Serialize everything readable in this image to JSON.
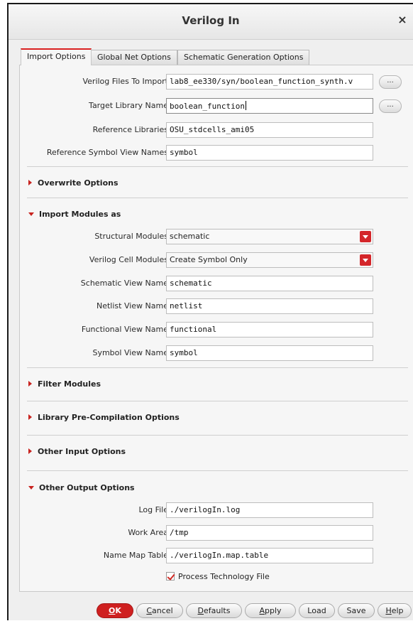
{
  "window": {
    "title": "Verilog In",
    "close_glyph": "×"
  },
  "tabs": [
    {
      "label": "Import Options",
      "active": true
    },
    {
      "label": "Global Net Options",
      "active": false
    },
    {
      "label": "Schematic Generation Options",
      "active": false
    }
  ],
  "fields": {
    "verilog_files": {
      "label": "Verilog Files To Import",
      "value": "lab8_ee330/syn/boolean_function_synth.v"
    },
    "target_library": {
      "label": "Target Library Name",
      "value": "boolean_function"
    },
    "reference_libraries": {
      "label": "Reference Libraries",
      "value": "OSU_stdcells_ami05"
    },
    "reference_symbol_views": {
      "label": "Reference Symbol View Names",
      "value": "symbol"
    }
  },
  "browse_label": "...",
  "sections": {
    "overwrite": "Overwrite Options",
    "import_modules": "Import Modules as",
    "filter_modules": "Filter Modules",
    "library_precompilation": "Library Pre-Compilation Options",
    "other_input": "Other Input Options",
    "other_output": "Other Output Options"
  },
  "import_modules": {
    "structural_modules": {
      "label": "Structural Modules",
      "value": "schematic"
    },
    "verilog_cell_modules": {
      "label": "Verilog Cell Modules",
      "value": "Create Symbol Only"
    },
    "schematic_view_name": {
      "label": "Schematic View Name",
      "value": "schematic"
    },
    "netlist_view_name": {
      "label": "Netlist View Name",
      "value": "netlist"
    },
    "functional_view_name": {
      "label": "Functional View Name",
      "value": "functional"
    },
    "symbol_view_name": {
      "label": "Symbol View Name",
      "value": "symbol"
    }
  },
  "other_output": {
    "log_file": {
      "label": "Log File",
      "value": "./verilogIn.log"
    },
    "work_area": {
      "label": "Work Area",
      "value": "/tmp"
    },
    "name_map_table": {
      "label": "Name Map Table",
      "value": "./verilogIn.map.table"
    },
    "process_technology_file": {
      "label": "Process Technology File",
      "checked": true
    }
  },
  "buttons": {
    "ok": {
      "mnemonic": "O",
      "rest": "K"
    },
    "cancel": {
      "mnemonic": "C",
      "rest": "ancel"
    },
    "defaults": {
      "mnemonic": "D",
      "rest": "efaults"
    },
    "apply": {
      "mnemonic": "A",
      "rest": "pply"
    },
    "load": {
      "mnemonic": "",
      "rest": "Load"
    },
    "save": {
      "mnemonic": "",
      "rest": "Save"
    },
    "help": {
      "mnemonic": "H",
      "rest": "elp"
    }
  },
  "colors": {
    "accent": "#d4262a",
    "panel": "#f6f6f6"
  }
}
